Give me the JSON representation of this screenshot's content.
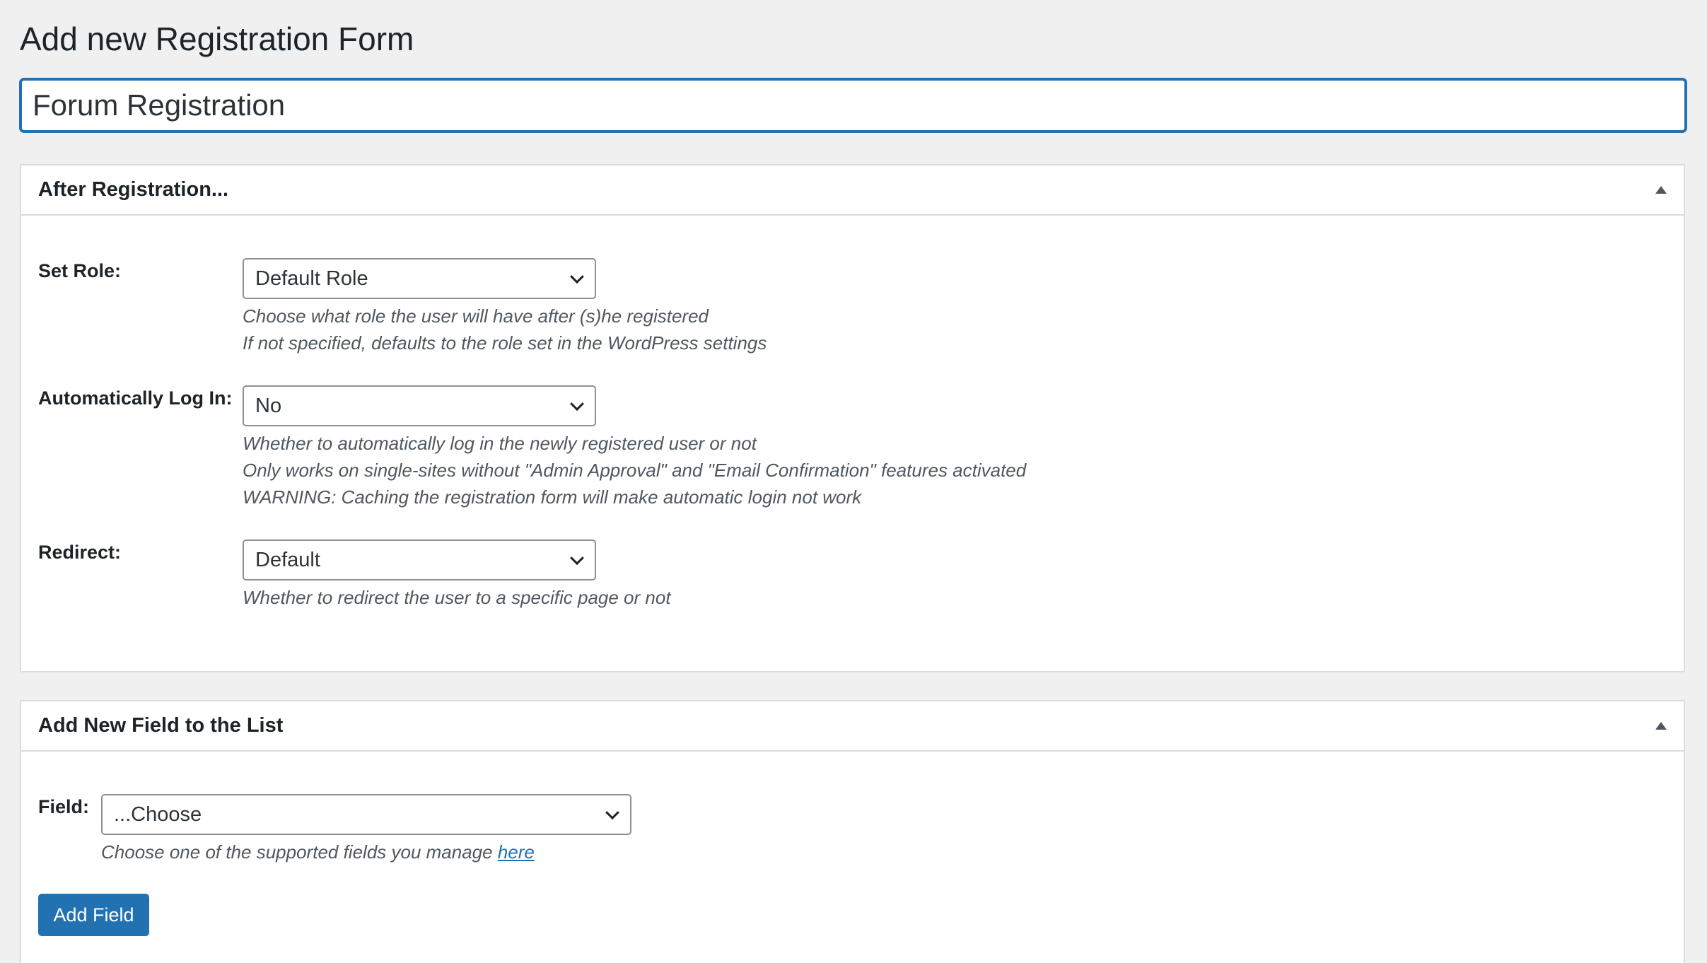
{
  "page": {
    "title": "Add new Registration Form",
    "form_name_value": "Forum Registration"
  },
  "after_registration": {
    "heading": "After Registration...",
    "set_role": {
      "label": "Set Role:",
      "selected": "Default Role",
      "desc_line1": "Choose what role the user will have after (s)he registered",
      "desc_line2": "If not specified, defaults to the role set in the WordPress settings"
    },
    "auto_login": {
      "label": "Automatically Log In:",
      "selected": "No",
      "desc_line1": "Whether to automatically log in the newly registered user or not",
      "desc_line2": "Only works on single-sites without \"Admin Approval\" and \"Email Confirmation\" features activated",
      "desc_line3": "WARNING: Caching the registration form will make automatic login not work"
    },
    "redirect": {
      "label": "Redirect:",
      "selected": "Default",
      "desc_line1": "Whether to redirect the user to a specific page or not"
    }
  },
  "add_field": {
    "heading": "Add New Field to the List",
    "field_label": "Field:",
    "field_selected": "...Choose",
    "desc_text": "Choose one of the supported fields you manage ",
    "desc_link": "here",
    "button_label": "Add Field"
  },
  "icons": {
    "toggle": "arrow-up-icon",
    "dropdown": "chevron-down-icon"
  },
  "colors": {
    "accent": "#2271b1",
    "background": "#f0f0f1",
    "border": "#dcdcde"
  }
}
